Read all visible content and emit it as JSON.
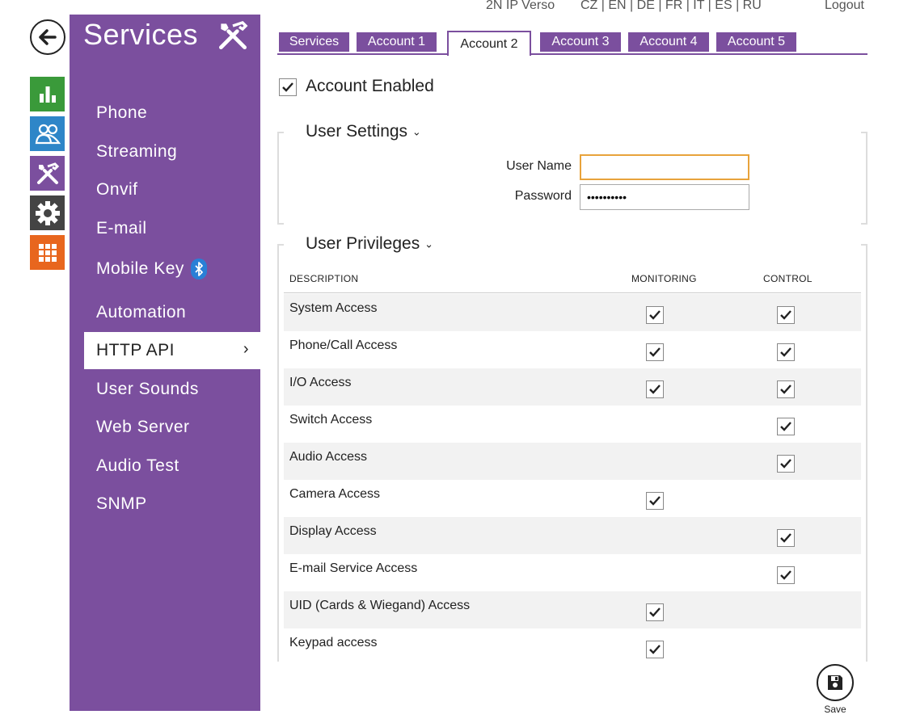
{
  "header": {
    "device_name": "2N IP Verso",
    "languages": "CZ | EN | DE | FR | IT | ES | RU",
    "logout": "Logout"
  },
  "rail": {
    "back_icon": "arrow-left-icon",
    "items": [
      {
        "icon": "bar-chart-icon",
        "color": "#3a9a3a"
      },
      {
        "icon": "users-icon",
        "color": "#2e86c8"
      },
      {
        "icon": "tools-icon",
        "color": "#7b4f9e"
      },
      {
        "icon": "gear-icon",
        "color": "#444444"
      },
      {
        "icon": "grid-icon",
        "color": "#e8661e"
      }
    ]
  },
  "sidebar": {
    "title": "Services",
    "title_icon": "tools-icon",
    "color": "#7b4f9e",
    "items": [
      {
        "label": "Phone"
      },
      {
        "label": "Streaming"
      },
      {
        "label": "Onvif"
      },
      {
        "label": "E-mail"
      },
      {
        "label": "Mobile Key",
        "icon": "bluetooth-icon"
      },
      {
        "label": "Automation"
      },
      {
        "label": "HTTP API",
        "active": true
      },
      {
        "label": "User Sounds"
      },
      {
        "label": "Web Server"
      },
      {
        "label": "Audio Test"
      },
      {
        "label": "SNMP"
      }
    ]
  },
  "tabs": [
    {
      "label": "Services"
    },
    {
      "label": "Account 1"
    },
    {
      "label": "Account 2",
      "active": true
    },
    {
      "label": "Account 3"
    },
    {
      "label": "Account 4"
    },
    {
      "label": "Account 5"
    }
  ],
  "account": {
    "enabled_label": "Account Enabled",
    "enabled": true
  },
  "user_settings": {
    "title": "User Settings",
    "username_label": "User Name",
    "username_value": "",
    "password_label": "Password",
    "password_value": "••••••••••"
  },
  "privileges": {
    "title": "User Privileges",
    "col_description": "DESCRIPTION",
    "col_monitoring": "MONITORING",
    "col_control": "CONTROL",
    "rows": [
      {
        "label": "System Access",
        "monitoring": true,
        "control": true
      },
      {
        "label": "Phone/Call Access",
        "monitoring": true,
        "control": true
      },
      {
        "label": "I/O Access",
        "monitoring": true,
        "control": true
      },
      {
        "label": "Switch Access",
        "monitoring": false,
        "control": true
      },
      {
        "label": "Audio Access",
        "monitoring": false,
        "control": true
      },
      {
        "label": "Camera Access",
        "monitoring": true,
        "control": false
      },
      {
        "label": "Display Access",
        "monitoring": false,
        "control": true
      },
      {
        "label": "E-mail Service Access",
        "monitoring": false,
        "control": true
      },
      {
        "label": "UID (Cards & Wiegand) Access",
        "monitoring": true,
        "control": false
      },
      {
        "label": "Keypad access",
        "monitoring": true,
        "control": false
      }
    ]
  },
  "save": {
    "label": "Save",
    "icon": "floppy-disk-icon"
  }
}
